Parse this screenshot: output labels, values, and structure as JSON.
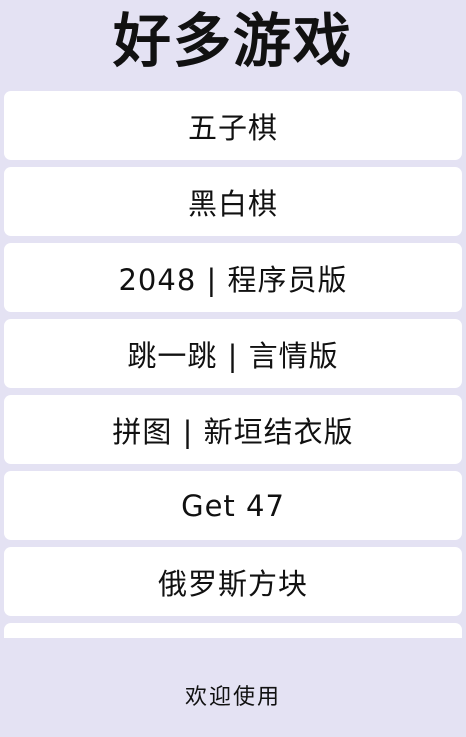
{
  "app": {
    "title": "好多游戏"
  },
  "games": [
    {
      "label": "五子棋"
    },
    {
      "label": "黑白棋"
    },
    {
      "label": "2048 | 程序员版"
    },
    {
      "label": "跳一跳 | 言情版"
    },
    {
      "label": "拼图 | 新垣结衣版"
    },
    {
      "label": "Get 47"
    },
    {
      "label": "俄罗斯方块"
    },
    {
      "label": ""
    }
  ],
  "footer": {
    "text": "欢迎使用"
  },
  "colors": {
    "background": "#e4e2f3",
    "card": "#ffffff",
    "text": "#111111"
  }
}
